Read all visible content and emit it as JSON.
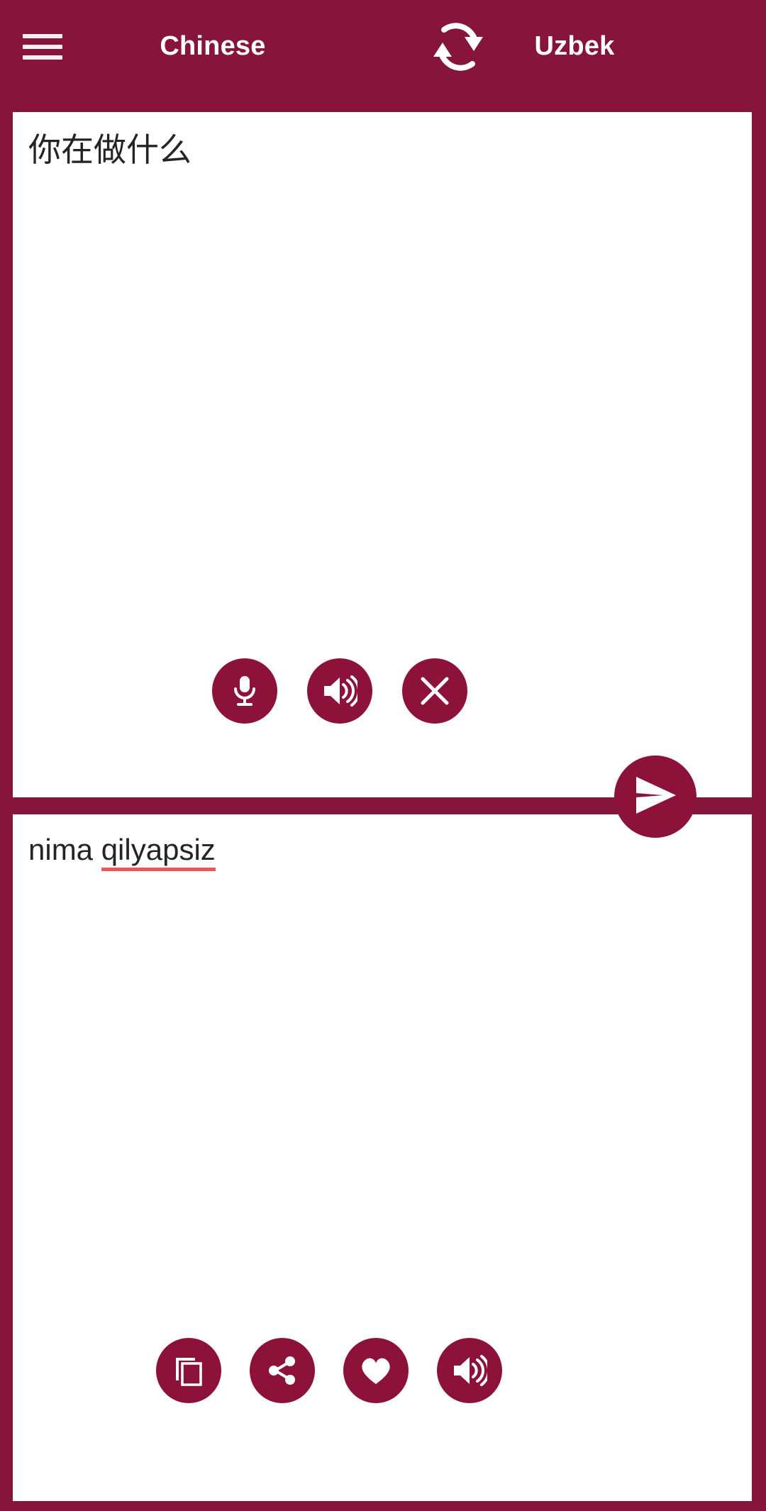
{
  "app": {
    "accent_color": "#87143A",
    "button_color": "#8C1239",
    "panel_color": "#FFFFFF",
    "spellcheck_underline_color": "#E8565A"
  },
  "header": {
    "menu_icon": "hamburger-menu-icon",
    "source_language": "Chinese",
    "swap_icon": "swap-languages-icon",
    "target_language": "Uzbek"
  },
  "source_panel": {
    "text": "你在做什么",
    "placeholder": "",
    "actions": [
      {
        "name": "microphone",
        "icon": "microphone-icon",
        "label": "Voice input"
      },
      {
        "name": "speak",
        "icon": "speaker-icon",
        "label": "Listen"
      },
      {
        "name": "clear",
        "icon": "close-x-icon",
        "label": "Clear"
      }
    ]
  },
  "send_button": {
    "icon": "send-paper-plane-icon",
    "label": "Translate"
  },
  "target_panel": {
    "text_prefix": "nima ",
    "text_misspelled": "qilyapsiz",
    "full_text": "nima qilyapsiz",
    "actions": [
      {
        "name": "copy",
        "icon": "copy-icon",
        "label": "Copy"
      },
      {
        "name": "share",
        "icon": "share-icon",
        "label": "Share"
      },
      {
        "name": "favorite",
        "icon": "heart-icon",
        "label": "Favorite"
      },
      {
        "name": "speak",
        "icon": "speaker-icon",
        "label": "Listen"
      }
    ]
  }
}
